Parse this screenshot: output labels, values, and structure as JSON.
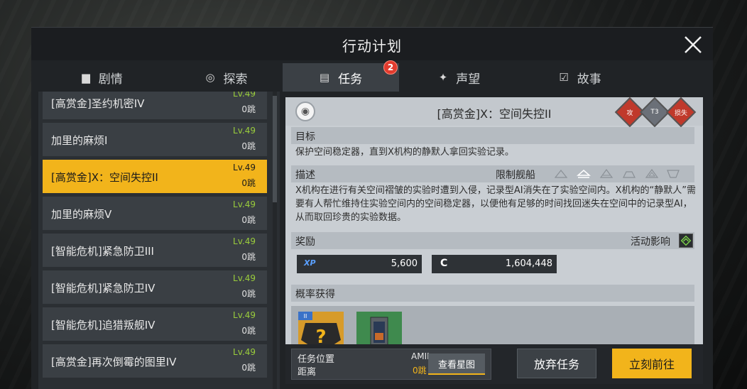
{
  "window": {
    "title": "行动计划"
  },
  "tabs": [
    {
      "label": "剧情",
      "icon": "book-icon"
    },
    {
      "label": "探索",
      "icon": "explore-icon"
    },
    {
      "label": "任务",
      "icon": "mission-icon",
      "badge": "2"
    },
    {
      "label": "声望",
      "icon": "reputation-icon"
    },
    {
      "label": "故事",
      "icon": "story-icon"
    }
  ],
  "missions": [
    {
      "name": "[高赏金]圣约机密IV",
      "level": "Lv.49",
      "jumps": "0跳"
    },
    {
      "name": "加里的麻烦I",
      "level": "Lv.49",
      "jumps": "0跳"
    },
    {
      "name": "[高赏金]X：空间失控II",
      "level": "Lv.49",
      "jumps": "0跳"
    },
    {
      "name": "加里的麻烦V",
      "level": "Lv.49",
      "jumps": "0跳"
    },
    {
      "name": "[智能危机]紧急防卫III",
      "level": "Lv.49",
      "jumps": "0跳"
    },
    {
      "name": "[智能危机]紧急防卫IV",
      "level": "Lv.49",
      "jumps": "0跳"
    },
    {
      "name": "[智能危机]追猎叛舰IV",
      "level": "Lv.49",
      "jumps": "0跳"
    },
    {
      "name": "[高赏金]再次倒霉的图里IV",
      "level": "Lv.49",
      "jumps": "0跳"
    }
  ],
  "detail": {
    "title": "[高赏金]X：空间失控II",
    "tags": [
      {
        "text": "攻",
        "color": "#c0392b"
      },
      {
        "text": "T3",
        "color": "#6b7078"
      },
      {
        "text": "损失",
        "color": "#c0392b"
      }
    ],
    "objective_label": "目标",
    "objective_text": "保护空间稳定器，直到X机构的静默人拿回实验记录。",
    "description_label": "描述",
    "restrict_label": "限制舰船",
    "description_text": "X机构在进行有关空间褶皱的实验时遭到入侵，记录型AI消失在了实验空间内。X机构的“静默人”需要有人帮忙维持住实验空间内的空间稳定器，以便他有足够的时间找回迷失在空间中的记录型AI，从而取回珍贵的实验数据。",
    "reward_label": "奖励",
    "activity_label": "活动影响",
    "xp_label": "XP",
    "xp_value": "5,600",
    "credit_label": "C",
    "credit_value": "1,604,448",
    "drop_label": "概率获得",
    "drop_badge": "II"
  },
  "bottom": {
    "location_label": "任务位置",
    "distance_label": "距离",
    "location_value": "AMII",
    "distance_value": "0跳",
    "starmap_button": "查看星图",
    "abandon_button": "放弃任务",
    "goto_button": "立刻前往"
  }
}
